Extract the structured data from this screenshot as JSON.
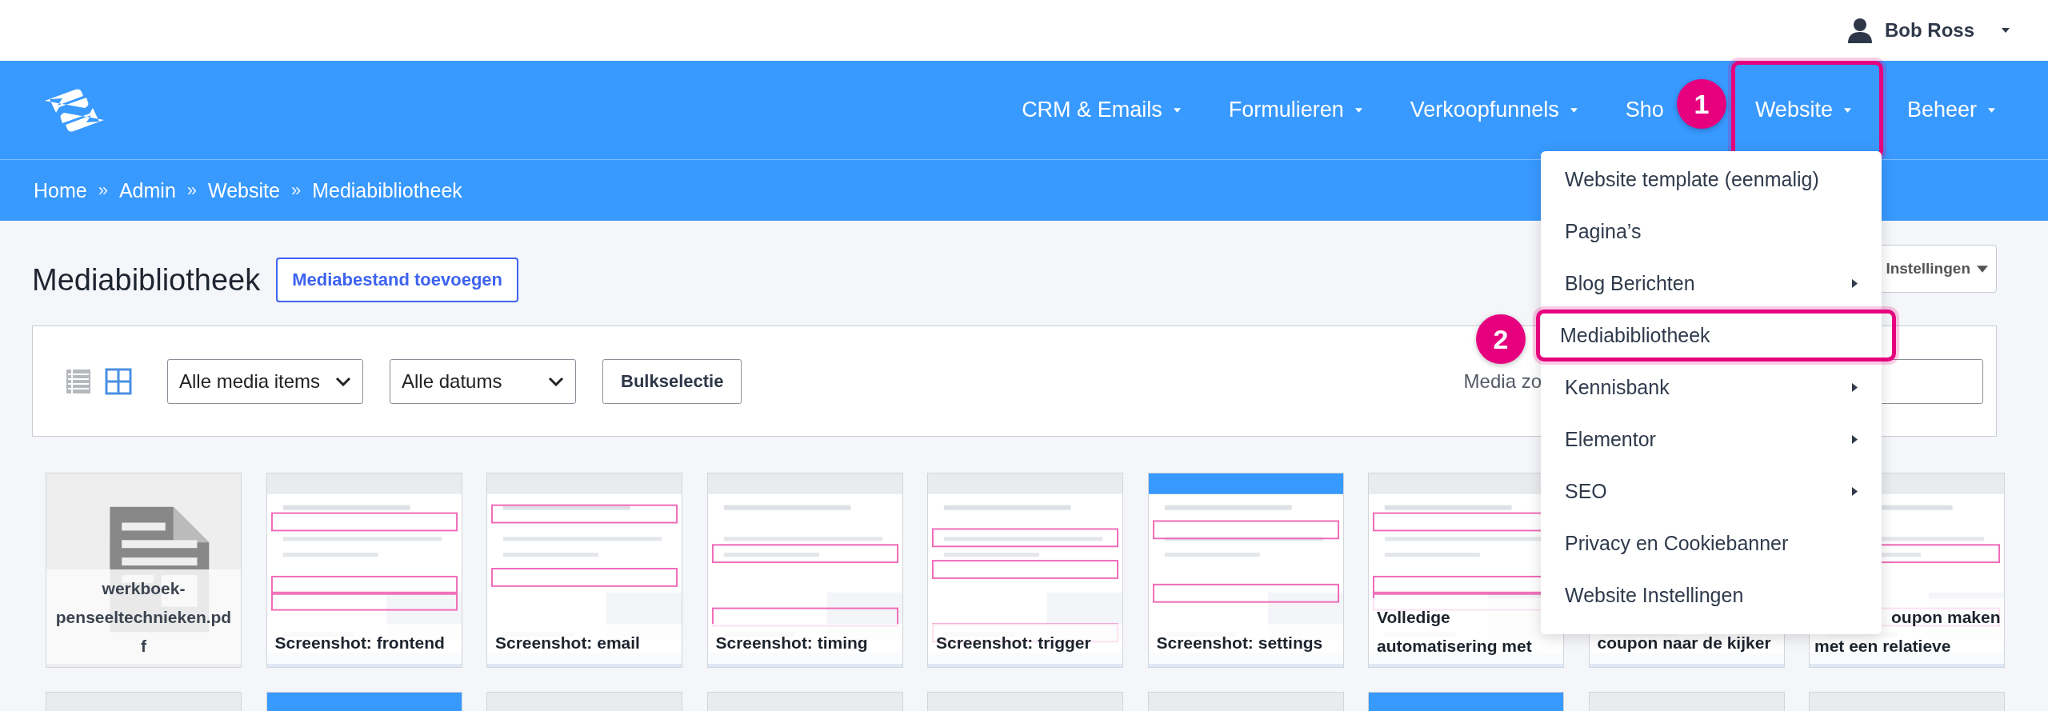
{
  "user_menu": {
    "name": "Bob Ross"
  },
  "nav": {
    "items": [
      {
        "label": "CRM & Emails",
        "caret": true,
        "highlighted": false
      },
      {
        "label": "Formulieren",
        "caret": true,
        "highlighted": false
      },
      {
        "label": "Verkoopfunnels",
        "caret": true,
        "highlighted": false
      },
      {
        "label": "Sho",
        "caret": false,
        "highlighted": false
      },
      {
        "label": "Website",
        "caret": true,
        "highlighted": true
      },
      {
        "label": "Beheer",
        "caret": true,
        "highlighted": false
      }
    ]
  },
  "breadcrumb": {
    "separator": "»",
    "items": [
      "Home",
      "Admin",
      "Website",
      "Mediabibliotheek"
    ]
  },
  "page": {
    "title": "Mediabibliotheek",
    "add_button": "Mediabestand toevoegen",
    "settings_button": "Instellingen"
  },
  "toolbar": {
    "views": [
      {
        "kind": "list",
        "selected": false
      },
      {
        "kind": "grid",
        "selected": true
      }
    ],
    "type_filter": "Alle media items",
    "date_filter": "Alle datums",
    "bulk_button": "Bulkselectie",
    "search_label": "Media zo"
  },
  "media": [
    {
      "kind": "document",
      "caption": [
        "werkboek-",
        "penseeltechnieken.pd",
        "f"
      ]
    },
    {
      "kind": "screenshot",
      "caption": [
        "Screenshot: frontend"
      ]
    },
    {
      "kind": "screenshot",
      "caption": [
        "Screenshot: email"
      ]
    },
    {
      "kind": "screenshot",
      "caption": [
        "Screenshot: timing"
      ]
    },
    {
      "kind": "screenshot",
      "caption": [
        "Screenshot: trigger"
      ]
    },
    {
      "kind": "screenshot",
      "caption": [
        "Screenshot: settings"
      ]
    },
    {
      "kind": "screenshot",
      "caption": [
        "Volledige",
        "automatisering met"
      ]
    },
    {
      "kind": "screenshot",
      "caption": [
        "coupon naar de kijker"
      ]
    },
    {
      "kind": "screenshot",
      "caption": [
        "oupon maken",
        "met een relatieve"
      ]
    },
    {
      "kind": "screenshot"
    },
    {
      "kind": "screenshot"
    },
    {
      "kind": "screenshot"
    },
    {
      "kind": "screenshot"
    },
    {
      "kind": "screenshot"
    },
    {
      "kind": "screenshot"
    },
    {
      "kind": "screenshot"
    },
    {
      "kind": "screenshot"
    },
    {
      "kind": "screenshot"
    }
  ],
  "dropdown": {
    "items": [
      {
        "label": "Website template (eenmalig)",
        "submenu": false,
        "highlighted": false
      },
      {
        "label": "Pagina’s",
        "submenu": false,
        "highlighted": false
      },
      {
        "label": "Blog Berichten",
        "submenu": true,
        "highlighted": false
      },
      {
        "label": "Mediabibliotheek",
        "submenu": false,
        "highlighted": true
      },
      {
        "label": "Kennisbank",
        "submenu": true,
        "highlighted": false
      },
      {
        "label": "Elementor",
        "submenu": true,
        "highlighted": false
      },
      {
        "label": "SEO",
        "submenu": true,
        "highlighted": false
      },
      {
        "label": "Privacy en Cookiebanner",
        "submenu": false,
        "highlighted": false
      },
      {
        "label": "Website Instellingen",
        "submenu": false,
        "highlighted": false
      }
    ]
  },
  "annotations": [
    {
      "number": "1"
    },
    {
      "number": "2"
    }
  ]
}
